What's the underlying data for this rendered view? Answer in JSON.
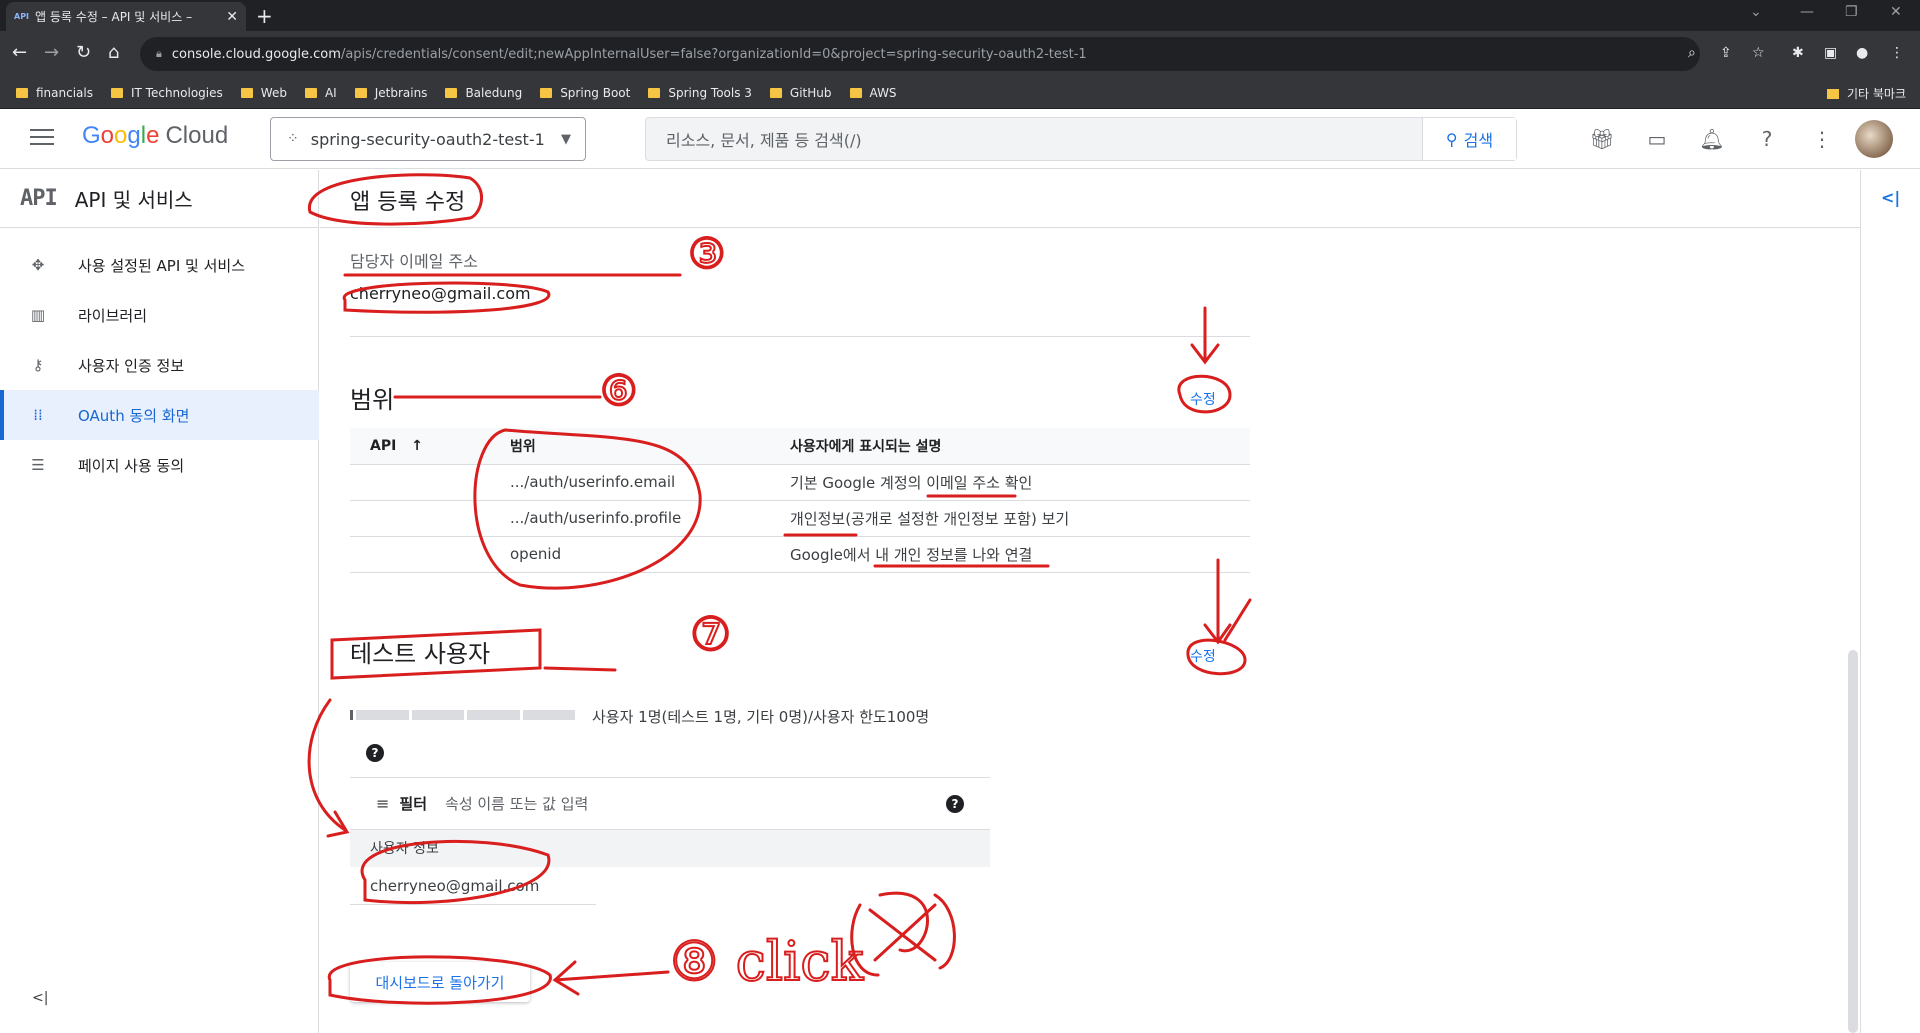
{
  "browser": {
    "tab_title": "앱 등록 수정 – API 및 서비스 – ",
    "tab_favicon": "API",
    "url_host": "console.cloud.google.com",
    "url_path": "/apis/credentials/consent/edit;newAppInternalUser=false?organizationId=0&project=spring-security-oauth2-test-1",
    "bookmarks": [
      "financials",
      "IT Technologies",
      "Web",
      "AI",
      "Jetbrains",
      "Baledung",
      "Spring Boot",
      "Spring Tools 3",
      "GitHub",
      "AWS"
    ],
    "other_bookmarks": "기타 북마크"
  },
  "header": {
    "logo_google": [
      "G",
      "o",
      "o",
      "g",
      "l",
      "e"
    ],
    "logo_cloud": "Cloud",
    "project": "spring-security-oauth2-test-1",
    "search_placeholder": "리소스, 문서, 제품 등 검색(/)",
    "search_button": "검색"
  },
  "sidebar": {
    "api_badge": "API",
    "title": "API 및 서비스",
    "items": [
      {
        "label": "사용 설정된 API 및 서비스",
        "icon": "apis-icon"
      },
      {
        "label": "라이브러리",
        "icon": "library-icon"
      },
      {
        "label": "사용자 인증 정보",
        "icon": "key-icon"
      },
      {
        "label": "OAuth 동의 화면",
        "icon": "consent-icon",
        "active": true
      },
      {
        "label": "페이지 사용 동의",
        "icon": "settings-list-icon"
      }
    ]
  },
  "page": {
    "title": "앱 등록 수정",
    "contact_label": "담당자 이메일 주소",
    "contact_email": "cherryneo@gmail.com",
    "scopes_title": "범위",
    "edit_label": "수정",
    "scopes_table": {
      "headers": [
        "API",
        "범위",
        "사용자에게 표시되는 설명"
      ],
      "rows": [
        {
          "api": "",
          "scope": ".../auth/userinfo.email",
          "desc": "기본 Google 계정의 이메일 주소 확인"
        },
        {
          "api": "",
          "scope": ".../auth/userinfo.profile",
          "desc": "개인정보(공개로 설정한 개인정보 포함) 보기"
        },
        {
          "api": "",
          "scope": "openid",
          "desc": "Google에서 내 개인 정보를 나와 연결"
        }
      ]
    },
    "test_users_title": "테스트 사용자",
    "user_count_text": "사용자 1명(테스트 1명, 기타 0명)/사용자 한도100명",
    "user_quota_fraction": 0.01,
    "filter_label": "필터",
    "filter_placeholder": "속성 이름 또는 값 입력",
    "user_info_header": "사용자 정보",
    "test_user_email": "cherryneo@gmail.com",
    "back_button": "대시보드로 돌아가기"
  },
  "annotations": {
    "num_3": "③",
    "num_6": "⑥",
    "num_7": "⑦",
    "num_8_click": "⑧ click"
  }
}
